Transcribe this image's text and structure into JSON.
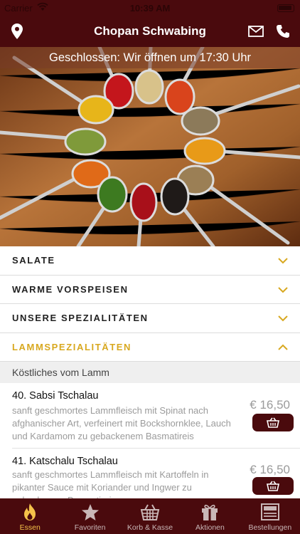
{
  "status_bar": {
    "carrier": "Carrier",
    "time": "10:39 AM"
  },
  "header": {
    "title": "Chopan Schwabing",
    "location_icon": "map-pin-icon",
    "mail_icon": "envelope-icon",
    "phone_icon": "phone-icon"
  },
  "hero": {
    "status_banner": "Geschlossen: Wir öffnen um 17:30 Uhr"
  },
  "categories": [
    {
      "label": "SALATE",
      "expanded": false
    },
    {
      "label": "WARME VORSPEISEN",
      "expanded": false
    },
    {
      "label": "UNSERE SPEZIALITÄTEN",
      "expanded": false
    },
    {
      "label": "LAMMSPEZIALITÄTEN",
      "expanded": true
    }
  ],
  "section": {
    "subtitle": "Köstliches vom Lamm"
  },
  "items": [
    {
      "name": "40. Sabsi Tschalau",
      "description": "sanft geschmortes Lammfleisch mit Spinat nach afghanischer Art, verfeinert mit Bockshornklee, Lauch und Kardamom zu gebackenem Basmatireis",
      "price": "€ 16,50"
    },
    {
      "name": "41. Katschalu Tschalau",
      "description": "sanft geschmortes Lammfleisch mit Kartoffeln in pikanter Sauce mit Koriander und Ingwer zu gebackenem Basmatireis",
      "price": "€ 16,50"
    }
  ],
  "tabs": [
    {
      "label": "Essen",
      "icon": "flame-icon",
      "active": true
    },
    {
      "label": "Favoriten",
      "icon": "star-icon",
      "active": false
    },
    {
      "label": "Korb & Kasse",
      "icon": "basket-icon",
      "active": false
    },
    {
      "label": "Aktionen",
      "icon": "gift-icon",
      "active": false
    },
    {
      "label": "Bestellungen",
      "icon": "orders-icon",
      "active": false
    }
  ],
  "colors": {
    "brand": "#4a0a0d",
    "accent": "#d8a81f",
    "tab_active": "#f5c24a"
  }
}
